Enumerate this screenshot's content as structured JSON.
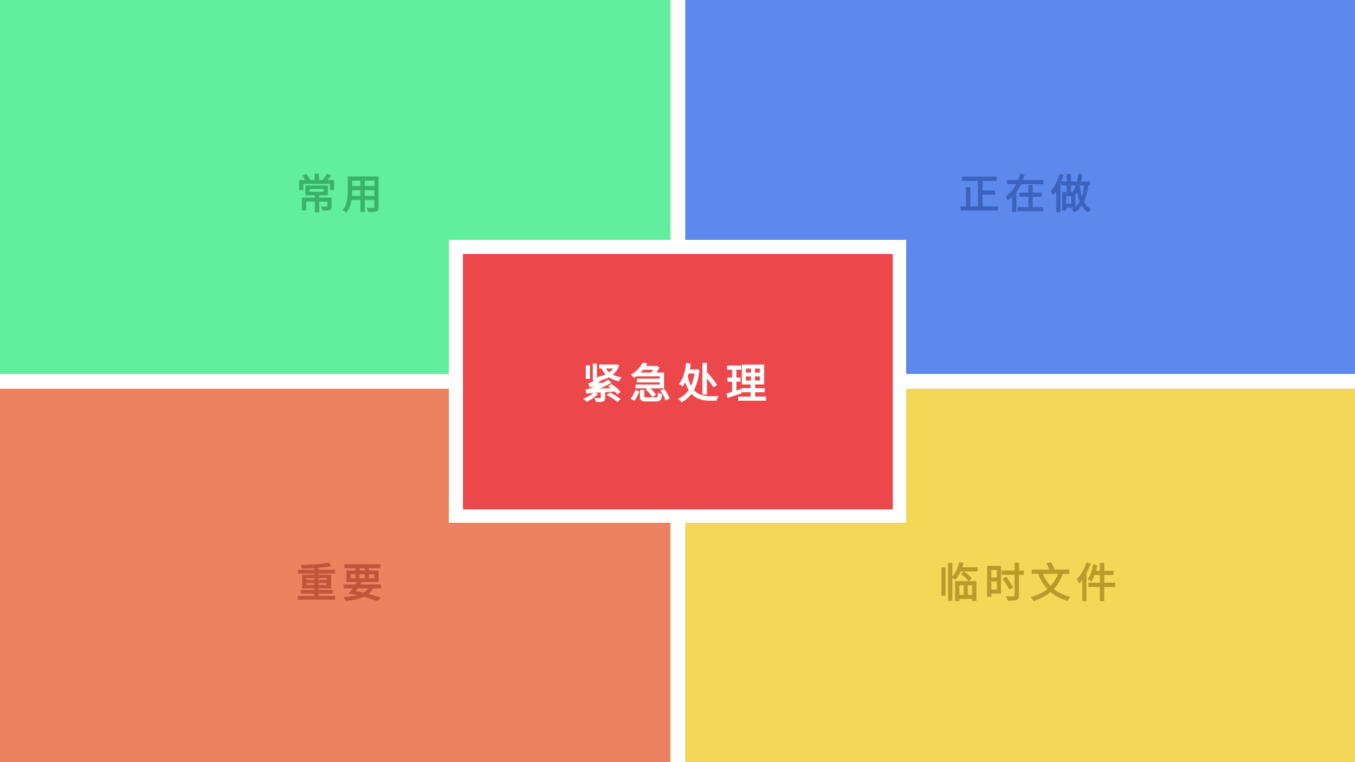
{
  "zones": {
    "top_left": {
      "label": "常用",
      "bg": "#61EF9E",
      "text_color": "#3BB26A"
    },
    "top_right": {
      "label": "正在做",
      "bg": "#5C89EB",
      "text_color": "#3A62BE"
    },
    "bottom_left": {
      "label": "重要",
      "bg": "#ED8260",
      "text_color": "#C0553A"
    },
    "bottom_right": {
      "label": "临时文件",
      "bg": "#F2D856",
      "text_color": "#B89B2A"
    },
    "center": {
      "label": "紧急处理",
      "bg": "#EC474A",
      "text_color": "#FFFFFF"
    }
  }
}
